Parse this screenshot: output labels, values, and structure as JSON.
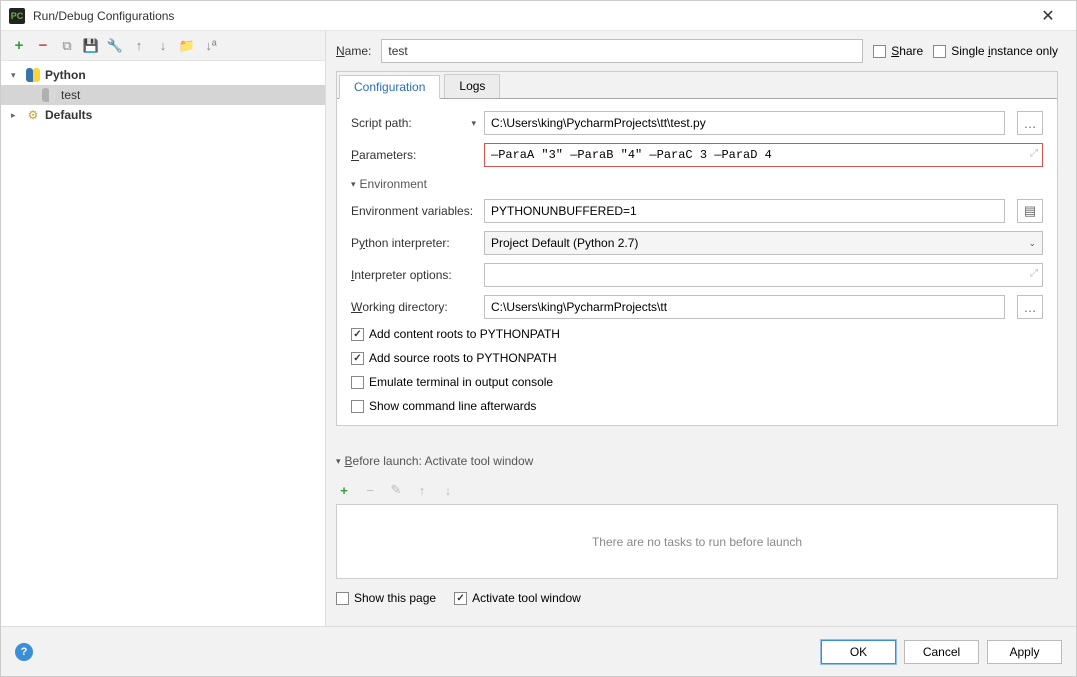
{
  "window": {
    "title": "Run/Debug Configurations",
    "icon_label": "PC"
  },
  "sidebar": {
    "items": [
      {
        "label": "Python",
        "expanded": true,
        "bold": true
      },
      {
        "label": "test",
        "selected": true
      },
      {
        "label": "Defaults",
        "expanded": false
      }
    ]
  },
  "form": {
    "name_label": "Name:",
    "name_value": "test",
    "share_label": "Share",
    "single_instance_label": "Single instance only"
  },
  "tabs": {
    "configuration": "Configuration",
    "logs": "Logs"
  },
  "config": {
    "script_path_label": "Script path:",
    "script_path_value": "C:\\Users\\king\\PycharmProjects\\tt\\test.py",
    "parameters_label": "Parameters:",
    "parameters_value": "—ParaA \"3\" —ParaB \"4\" —ParaC 3 —ParaD 4",
    "environment_header": "Environment",
    "env_vars_label": "Environment variables:",
    "env_vars_value": "PYTHONUNBUFFERED=1",
    "interpreter_label": "Python interpreter:",
    "interpreter_value": "Project Default (Python 2.7)",
    "interpreter_options_label": "Interpreter options:",
    "interpreter_options_value": "",
    "working_dir_label": "Working directory:",
    "working_dir_value": "C:\\Users\\king\\PycharmProjects\\tt",
    "checks": {
      "add_content_roots": "Add content roots to PYTHONPATH",
      "add_source_roots": "Add source roots to PYTHONPATH",
      "emulate_terminal": "Emulate terminal in output console",
      "show_cmdline": "Show command line afterwards"
    }
  },
  "before_launch": {
    "header": "Before launch: Activate tool window",
    "empty_text": "There are no tasks to run before launch",
    "show_this_page": "Show this page",
    "activate_tool_window": "Activate tool window"
  },
  "footer": {
    "ok": "OK",
    "cancel": "Cancel",
    "apply": "Apply"
  }
}
